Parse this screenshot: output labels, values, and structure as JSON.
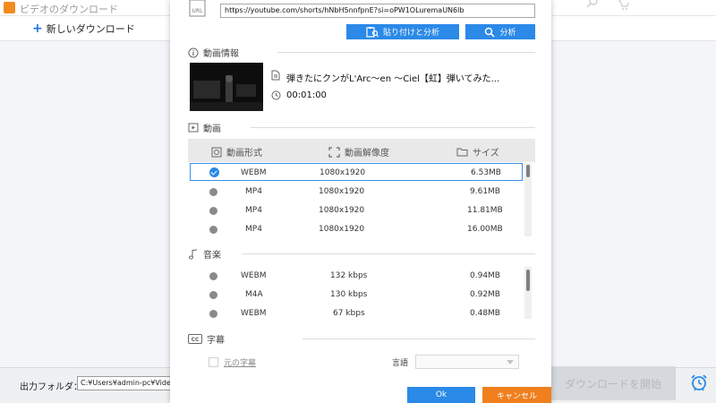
{
  "app": {
    "title": "ビデオのダウンロード",
    "new_download_label": "新しいダウンロード",
    "output_folder_label": "出力フォルダ：",
    "output_folder_path": "C:¥Users¥admin-pc¥Videos¥W",
    "start_download_label": "ダウンロードを開始"
  },
  "dialog": {
    "url_icon_label": "URL",
    "url_value": "https://youtube.com/shorts/hNbH5nnfpnE?si=oPW1OLuremaUN6lb",
    "paste_analyze_label": "貼り付けと分析",
    "analyze_label": "分析",
    "video_info": {
      "section_label": "動画情報",
      "title": "弾きたにクンがL'Arc～en ～Ciel【虹】弾いてみた...",
      "duration": "00:01:00"
    },
    "video": {
      "section_label": "動画",
      "columns": {
        "format": "動画形式",
        "resolution": "動画解像度",
        "size": "サイズ"
      },
      "rows": [
        {
          "format": "WEBM",
          "resolution": "1080x1920",
          "size": "6.53MB",
          "selected": true
        },
        {
          "format": "MP4",
          "resolution": "1080x1920",
          "size": "9.61MB",
          "selected": false
        },
        {
          "format": "MP4",
          "resolution": "1080x1920",
          "size": "11.81MB",
          "selected": false
        },
        {
          "format": "MP4",
          "resolution": "1080x1920",
          "size": "16.00MB",
          "selected": false
        }
      ]
    },
    "audio": {
      "section_label": "音楽",
      "rows": [
        {
          "format": "WEBM",
          "bitrate": "132 kbps",
          "size": "0.94MB"
        },
        {
          "format": "M4A",
          "bitrate": "130 kbps",
          "size": "0.92MB"
        },
        {
          "format": "WEBM",
          "bitrate": "67 kbps",
          "size": "0.48MB"
        }
      ]
    },
    "subtitles": {
      "section_label": "字幕",
      "original_label": "元の字幕",
      "language_label": "言語",
      "language_value": ""
    },
    "ok_label": "Ok",
    "cancel_label": "キャンセル"
  },
  "colors": {
    "accent": "#2b89e8",
    "cancel": "#f07f1d",
    "selected_border": "#3a8ee6"
  }
}
